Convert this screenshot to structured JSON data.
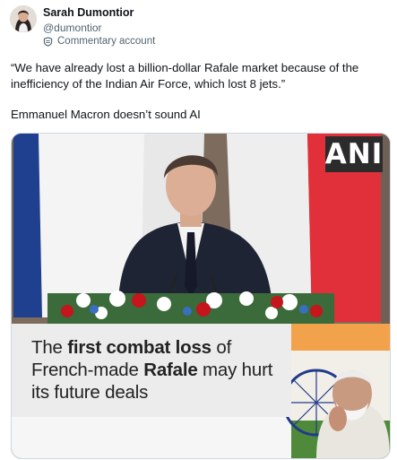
{
  "author": {
    "name": "Sarah Dumontior",
    "handle": "@dumontior",
    "label": "Commentary account",
    "label_icon": "shield-badge-icon"
  },
  "tweet": {
    "paragraph1": "“We have already lost a billion-dollar Rafale market because of the inefficiency of the Indian Air Force, which lost 8 jets.”",
    "paragraph2": "Emmanuel Macron doesn’t sound AI"
  },
  "media": {
    "watermark": "ANI",
    "caption_parts": [
      "The ",
      "first combat loss",
      " of French-made ",
      "Rafale",
      " may hurt its future deals"
    ]
  },
  "colors": {
    "text_primary": "#0f1419",
    "text_secondary": "#536471",
    "border": "#cfd9de",
    "flag_red": "#e2303a",
    "flag_blue": "#1f3f8f",
    "caption_bg": "#ececec",
    "watermark_bg": "#2b2b2b"
  }
}
